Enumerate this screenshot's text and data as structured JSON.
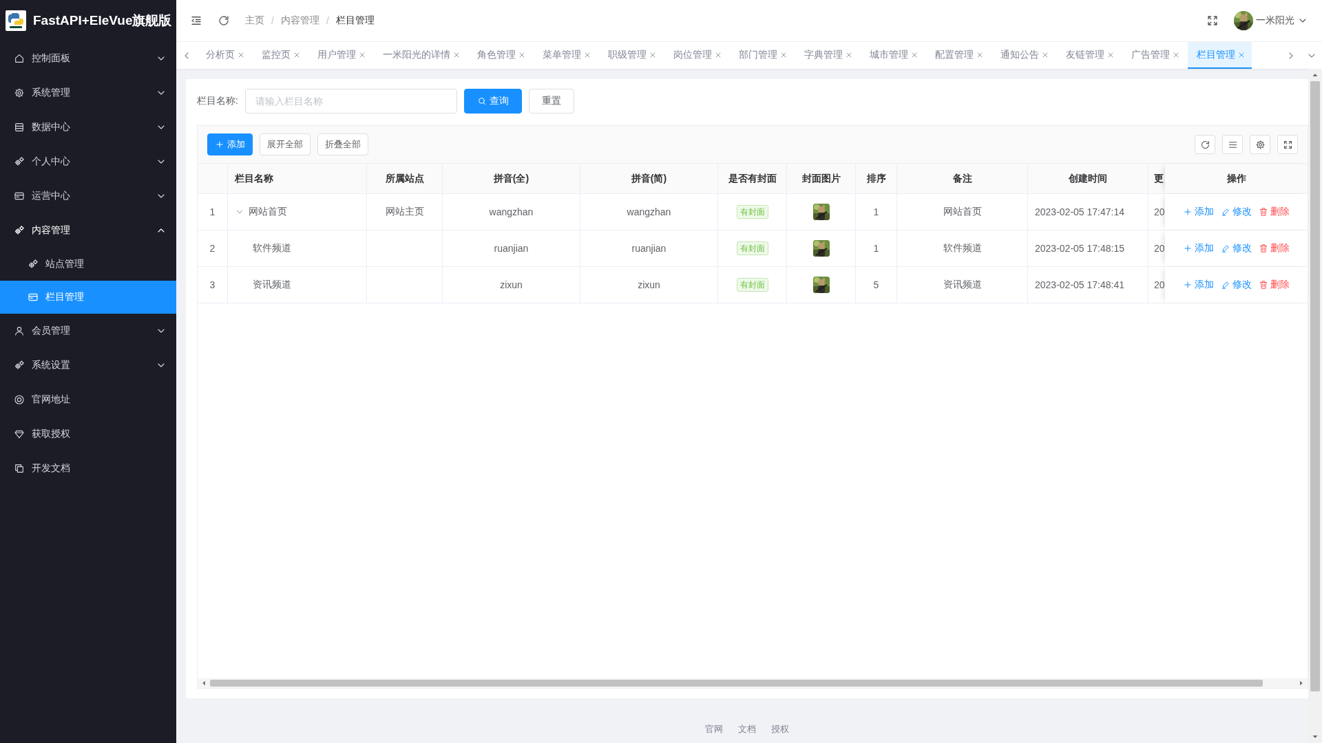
{
  "app": {
    "title": "FastAPI+EleVue旗舰版"
  },
  "sidebar": {
    "items": [
      {
        "label": "控制面板",
        "kind": "group",
        "expanded": false,
        "selected": false
      },
      {
        "label": "系统管理",
        "kind": "group",
        "expanded": false,
        "selected": false
      },
      {
        "label": "数据中心",
        "kind": "group",
        "expanded": false,
        "selected": false
      },
      {
        "label": "个人中心",
        "kind": "group",
        "expanded": false,
        "selected": false
      },
      {
        "label": "运营中心",
        "kind": "group",
        "expanded": false,
        "selected": false
      },
      {
        "label": "内容管理",
        "kind": "group",
        "expanded": true,
        "selected": false,
        "children": [
          {
            "label": "站点管理",
            "selected": false
          },
          {
            "label": "栏目管理",
            "selected": true
          }
        ]
      },
      {
        "label": "会员管理",
        "kind": "group",
        "expanded": false,
        "selected": false
      },
      {
        "label": "系统设置",
        "kind": "group",
        "expanded": false,
        "selected": false
      },
      {
        "label": "官网地址",
        "kind": "link",
        "selected": false
      },
      {
        "label": "获取授权",
        "kind": "link",
        "selected": false
      },
      {
        "label": "开发文档",
        "kind": "link",
        "selected": false
      }
    ]
  },
  "header": {
    "breadcrumb": [
      "主页",
      "内容管理",
      "栏目管理"
    ],
    "breadcrumb_separator": "/",
    "user": {
      "name": "一米阳光"
    }
  },
  "tabs": [
    {
      "label": "分析页",
      "selected": false
    },
    {
      "label": "监控页",
      "selected": false
    },
    {
      "label": "用户管理",
      "selected": false
    },
    {
      "label": "一米阳光的详情",
      "selected": false
    },
    {
      "label": "角色管理",
      "selected": false
    },
    {
      "label": "菜单管理",
      "selected": false
    },
    {
      "label": "职级管理",
      "selected": false
    },
    {
      "label": "岗位管理",
      "selected": false
    },
    {
      "label": "部门管理",
      "selected": false
    },
    {
      "label": "字典管理",
      "selected": false
    },
    {
      "label": "城市管理",
      "selected": false
    },
    {
      "label": "配置管理",
      "selected": false
    },
    {
      "label": "通知公告",
      "selected": false
    },
    {
      "label": "友链管理",
      "selected": false
    },
    {
      "label": "广告管理",
      "selected": false
    },
    {
      "label": "栏目管理",
      "selected": true
    }
  ],
  "search": {
    "label": "栏目名称:",
    "placeholder": "请输入栏目名称",
    "buttons": [
      {
        "label": "查询",
        "kind": "primary"
      },
      {
        "label": "重置",
        "kind": "default"
      }
    ]
  },
  "toolbar": {
    "buttons": [
      {
        "label": "添加",
        "kind": "primary"
      },
      {
        "label": "展开全部",
        "kind": "default"
      },
      {
        "label": "折叠全部",
        "kind": "default"
      }
    ]
  },
  "table": {
    "columns": [
      "栏目名称",
      "所属站点",
      "拼音(全)",
      "拼音(简)",
      "是否有封面",
      "封面图片",
      "排序",
      "备注",
      "创建时间",
      "更",
      "操作"
    ],
    "rows": [
      {
        "index": "1",
        "name": "网站首页",
        "expanded": true,
        "site": "网站主页",
        "pinyin_full": "wangzhan",
        "pinyin_short": "wangzhan",
        "cover_tag": "有封面",
        "cover": {
          "kind": "picture"
        },
        "sort": "1",
        "note": "网站首页",
        "created": "2023-02-05 17:47:14",
        "updated": "20",
        "actions": [
          {
            "label": "添加",
            "kind": "add"
          },
          {
            "label": "修改",
            "kind": "edit"
          },
          {
            "label": "删除",
            "kind": "delete"
          }
        ],
        "children": [
          {
            "index": "2",
            "name": "软件频道",
            "pinyin_full": "ruanjian",
            "pinyin_short": "ruanjian",
            "cover_tag": "有封面",
            "cover": {
              "kind": "picture"
            },
            "sort": "1",
            "note": "软件频道",
            "created": "2023-02-05 17:48:15",
            "updated": "20",
            "actions": [
              {
                "label": "添加",
                "kind": "add"
              },
              {
                "label": "修改",
                "kind": "edit"
              },
              {
                "label": "删除",
                "kind": "delete"
              }
            ]
          },
          {
            "index": "3",
            "name": "资讯频道",
            "pinyin_full": "zixun",
            "pinyin_short": "zixun",
            "cover_tag": "有封面",
            "cover": {
              "kind": "picture"
            },
            "sort": "5",
            "note": "资讯频道",
            "created": "2023-02-05 17:48:41",
            "updated": "20",
            "actions": [
              {
                "label": "添加",
                "kind": "add"
              },
              {
                "label": "修改",
                "kind": "edit"
              },
              {
                "label": "删除",
                "kind": "delete"
              }
            ]
          }
        ]
      }
    ]
  },
  "footer": {
    "links": [
      "官网",
      "文档",
      "授权"
    ]
  }
}
